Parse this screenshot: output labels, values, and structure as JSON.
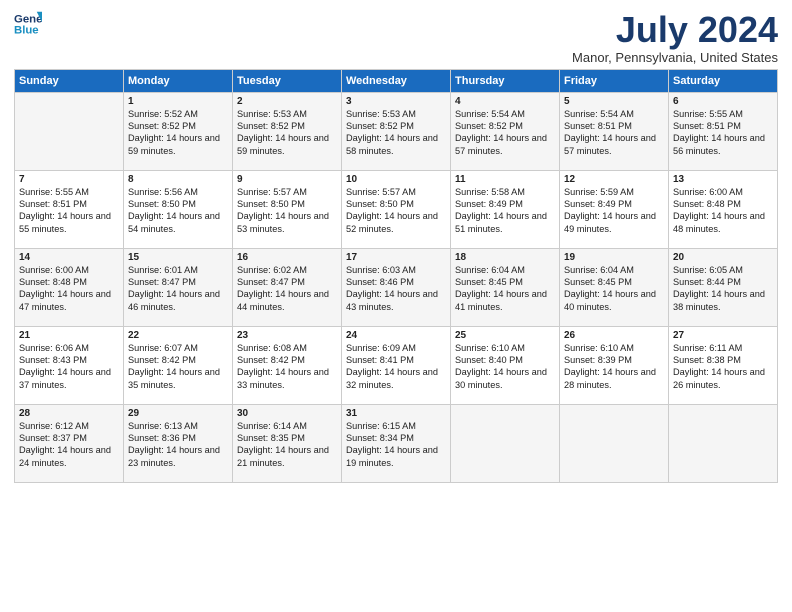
{
  "logo": {
    "line1": "General",
    "line2": "Blue",
    "icon_shape": "triangle"
  },
  "title": "July 2024",
  "subtitle": "Manor, Pennsylvania, United States",
  "header": {
    "colors": {
      "header_bg": "#1a6bbf",
      "odd_row": "#f5f5f5",
      "even_row": "#ffffff"
    }
  },
  "days_of_week": [
    "Sunday",
    "Monday",
    "Tuesday",
    "Wednesday",
    "Thursday",
    "Friday",
    "Saturday"
  ],
  "weeks": [
    {
      "cells": [
        {
          "day": null,
          "content": null
        },
        {
          "day": "1",
          "content": "Sunrise: 5:52 AM\nSunset: 8:52 PM\nDaylight: 14 hours\nand 59 minutes."
        },
        {
          "day": "2",
          "content": "Sunrise: 5:53 AM\nSunset: 8:52 PM\nDaylight: 14 hours\nand 59 minutes."
        },
        {
          "day": "3",
          "content": "Sunrise: 5:53 AM\nSunset: 8:52 PM\nDaylight: 14 hours\nand 58 minutes."
        },
        {
          "day": "4",
          "content": "Sunrise: 5:54 AM\nSunset: 8:52 PM\nDaylight: 14 hours\nand 57 minutes."
        },
        {
          "day": "5",
          "content": "Sunrise: 5:54 AM\nSunset: 8:51 PM\nDaylight: 14 hours\nand 57 minutes."
        },
        {
          "day": "6",
          "content": "Sunrise: 5:55 AM\nSunset: 8:51 PM\nDaylight: 14 hours\nand 56 minutes."
        }
      ]
    },
    {
      "cells": [
        {
          "day": "7",
          "content": "Sunrise: 5:55 AM\nSunset: 8:51 PM\nDaylight: 14 hours\nand 55 minutes."
        },
        {
          "day": "8",
          "content": "Sunrise: 5:56 AM\nSunset: 8:50 PM\nDaylight: 14 hours\nand 54 minutes."
        },
        {
          "day": "9",
          "content": "Sunrise: 5:57 AM\nSunset: 8:50 PM\nDaylight: 14 hours\nand 53 minutes."
        },
        {
          "day": "10",
          "content": "Sunrise: 5:57 AM\nSunset: 8:50 PM\nDaylight: 14 hours\nand 52 minutes."
        },
        {
          "day": "11",
          "content": "Sunrise: 5:58 AM\nSunset: 8:49 PM\nDaylight: 14 hours\nand 51 minutes."
        },
        {
          "day": "12",
          "content": "Sunrise: 5:59 AM\nSunset: 8:49 PM\nDaylight: 14 hours\nand 49 minutes."
        },
        {
          "day": "13",
          "content": "Sunrise: 6:00 AM\nSunset: 8:48 PM\nDaylight: 14 hours\nand 48 minutes."
        }
      ]
    },
    {
      "cells": [
        {
          "day": "14",
          "content": "Sunrise: 6:00 AM\nSunset: 8:48 PM\nDaylight: 14 hours\nand 47 minutes."
        },
        {
          "day": "15",
          "content": "Sunrise: 6:01 AM\nSunset: 8:47 PM\nDaylight: 14 hours\nand 46 minutes."
        },
        {
          "day": "16",
          "content": "Sunrise: 6:02 AM\nSunset: 8:47 PM\nDaylight: 14 hours\nand 44 minutes."
        },
        {
          "day": "17",
          "content": "Sunrise: 6:03 AM\nSunset: 8:46 PM\nDaylight: 14 hours\nand 43 minutes."
        },
        {
          "day": "18",
          "content": "Sunrise: 6:04 AM\nSunset: 8:45 PM\nDaylight: 14 hours\nand 41 minutes."
        },
        {
          "day": "19",
          "content": "Sunrise: 6:04 AM\nSunset: 8:45 PM\nDaylight: 14 hours\nand 40 minutes."
        },
        {
          "day": "20",
          "content": "Sunrise: 6:05 AM\nSunset: 8:44 PM\nDaylight: 14 hours\nand 38 minutes."
        }
      ]
    },
    {
      "cells": [
        {
          "day": "21",
          "content": "Sunrise: 6:06 AM\nSunset: 8:43 PM\nDaylight: 14 hours\nand 37 minutes."
        },
        {
          "day": "22",
          "content": "Sunrise: 6:07 AM\nSunset: 8:42 PM\nDaylight: 14 hours\nand 35 minutes."
        },
        {
          "day": "23",
          "content": "Sunrise: 6:08 AM\nSunset: 8:42 PM\nDaylight: 14 hours\nand 33 minutes."
        },
        {
          "day": "24",
          "content": "Sunrise: 6:09 AM\nSunset: 8:41 PM\nDaylight: 14 hours\nand 32 minutes."
        },
        {
          "day": "25",
          "content": "Sunrise: 6:10 AM\nSunset: 8:40 PM\nDaylight: 14 hours\nand 30 minutes."
        },
        {
          "day": "26",
          "content": "Sunrise: 6:10 AM\nSunset: 8:39 PM\nDaylight: 14 hours\nand 28 minutes."
        },
        {
          "day": "27",
          "content": "Sunrise: 6:11 AM\nSunset: 8:38 PM\nDaylight: 14 hours\nand 26 minutes."
        }
      ]
    },
    {
      "cells": [
        {
          "day": "28",
          "content": "Sunrise: 6:12 AM\nSunset: 8:37 PM\nDaylight: 14 hours\nand 24 minutes."
        },
        {
          "day": "29",
          "content": "Sunrise: 6:13 AM\nSunset: 8:36 PM\nDaylight: 14 hours\nand 23 minutes."
        },
        {
          "day": "30",
          "content": "Sunrise: 6:14 AM\nSunset: 8:35 PM\nDaylight: 14 hours\nand 21 minutes."
        },
        {
          "day": "31",
          "content": "Sunrise: 6:15 AM\nSunset: 8:34 PM\nDaylight: 14 hours\nand 19 minutes."
        },
        {
          "day": null,
          "content": null
        },
        {
          "day": null,
          "content": null
        },
        {
          "day": null,
          "content": null
        }
      ]
    }
  ]
}
